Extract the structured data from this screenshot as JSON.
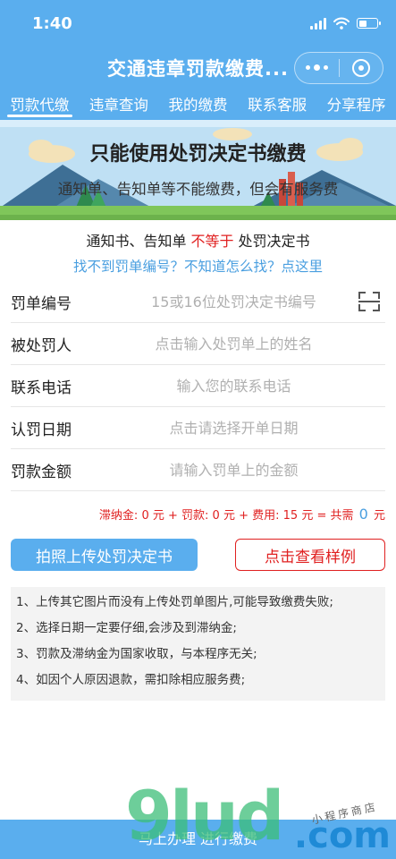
{
  "status_bar": {
    "time": "1:40"
  },
  "title_bar": {
    "title": "交通违章罚款缴费..."
  },
  "tabs": [
    {
      "label": "罚款代缴",
      "active": true
    },
    {
      "label": "违章查询",
      "active": false
    },
    {
      "label": "我的缴费",
      "active": false
    },
    {
      "label": "联系客服",
      "active": false
    },
    {
      "label": "分享程序",
      "active": false
    }
  ],
  "banner": {
    "title": "只能使用处罚决定书缴费",
    "subtitle": "通知单、告知单等不能缴费，但会有服务费"
  },
  "notice": {
    "left": "通知书、告知单",
    "highlight": "不等于",
    "right": "处罚决定书",
    "help_link": "找不到罚单编号？不知道怎么找？点这里"
  },
  "form": {
    "fields": [
      {
        "label": "罚单编号",
        "placeholder": "15或16位处罚决定书编号",
        "value": ""
      },
      {
        "label": "被处罚人",
        "placeholder": "点击输入处罚单上的姓名",
        "value": ""
      },
      {
        "label": "联系电话",
        "placeholder": "输入您的联系电话",
        "value": ""
      },
      {
        "label": "认罚日期",
        "placeholder": "点击请选择开单日期",
        "value": ""
      },
      {
        "label": "罚款金额",
        "placeholder": "请输入罚单上的金额",
        "value": ""
      }
    ]
  },
  "total": {
    "late_fee_label": "滞纳金:",
    "late_fee": "0",
    "fine_label": "元 + 罚款:",
    "fine": "0",
    "fee_label": "元 + 费用:",
    "fee": "15",
    "sum_label": "元 = 共需",
    "sum": "0",
    "unit": "元"
  },
  "buttons": {
    "upload": "拍照上传处罚决定书",
    "sample": "点击查看样例"
  },
  "notes": [
    "1、上传其它图片而没有上传处罚单图片,可能导致缴费失败;",
    "2、选择日期一定要仔细,会涉及到滞纳金;",
    "3、罚款及滞纳金为国家收取，与本程序无关;",
    "4、如因个人原因退款，需扣除相应服务费;"
  ],
  "bottom_bar": {
    "label": "马上办理 进行缴费"
  },
  "watermark": {
    "text": "9lud",
    "com": ".com",
    "sub": "小程序商店"
  },
  "colors": {
    "primary": "#5aaeee",
    "danger": "#e02020",
    "link": "#4a9fe0"
  }
}
